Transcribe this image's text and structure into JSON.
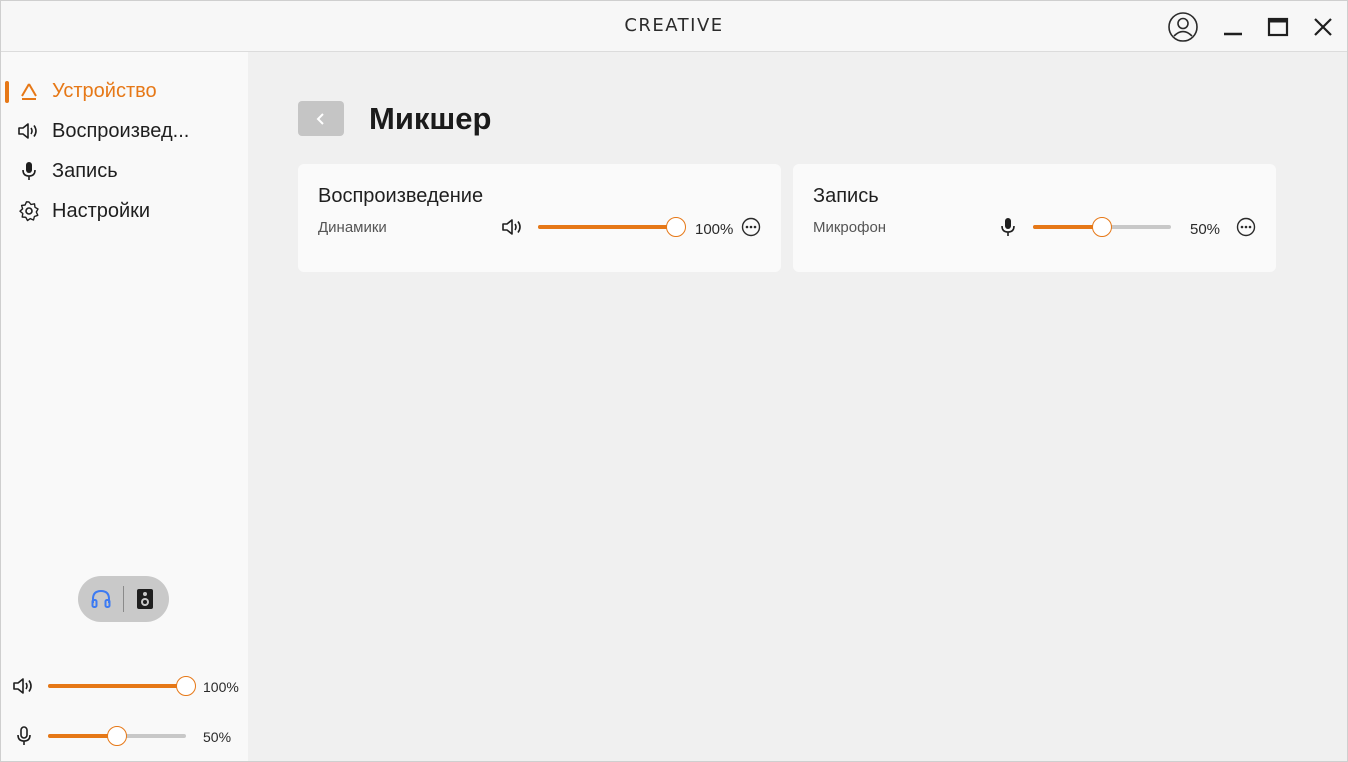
{
  "app": {
    "brand": "CREATIVE"
  },
  "sidebar": {
    "items": [
      {
        "label": "Устройство",
        "icon": "device-icon",
        "active": true
      },
      {
        "label": "Воспроизвед...",
        "icon": "speaker-icon",
        "active": false
      },
      {
        "label": "Запись",
        "icon": "microphone-icon",
        "active": false
      },
      {
        "label": "Настройки",
        "icon": "gear-icon",
        "active": false
      }
    ],
    "output_toggle": {
      "options": [
        "headphones-icon",
        "speaker-box-icon"
      ],
      "selected": "headphones-icon"
    },
    "volume": {
      "icon": "speaker-icon",
      "value": 100,
      "label": "100%"
    },
    "mic": {
      "icon": "microphone-icon",
      "value": 50,
      "label": "50%"
    }
  },
  "main": {
    "title": "Микшер",
    "cards": [
      {
        "title": "Воспроизведение",
        "channel": "Динамики",
        "icon": "speaker-icon",
        "value": 100,
        "label": "100%"
      },
      {
        "title": "Запись",
        "channel": "Микрофон",
        "icon": "microphone-icon",
        "value": 50,
        "label": "50%"
      }
    ]
  },
  "colors": {
    "accent": "#e67817",
    "headphone_active": "#3d7bf2"
  }
}
